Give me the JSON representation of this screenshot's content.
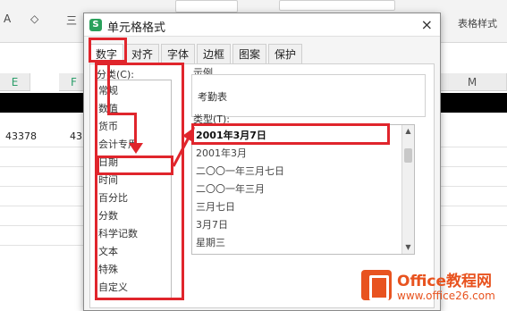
{
  "toolbar": {
    "font_glyph": "A",
    "fill_glyph": "◇",
    "align_glyph": "三",
    "table_style_label": "表格样式"
  },
  "grid": {
    "col_e": "E",
    "col_f": "F",
    "col_m": "M",
    "cell_e": "43378",
    "cell_f": "43"
  },
  "dialog": {
    "title": "单元格格式",
    "close_glyph": "×",
    "tabs": [
      "数字",
      "对齐",
      "字体",
      "边框",
      "图案",
      "保护"
    ],
    "category_label": "分类(C):",
    "categories": [
      "常规",
      "数值",
      "货币",
      "会计专用",
      "日期",
      "时间",
      "百分比",
      "分数",
      "科学记数",
      "文本",
      "特殊",
      "自定义"
    ],
    "sample_label": "示例",
    "sample_value": "考勤表",
    "type_label": "类型(T):",
    "types": [
      "2001年3月7日",
      "2001年3月",
      "二〇〇一年三月七日",
      "二〇〇一年三月",
      "三月七日",
      "3月7日",
      "星期三"
    ]
  },
  "watermark": {
    "title": "Office教程网",
    "url": "www.office26.com"
  },
  "colors": {
    "highlight": "#e0252c",
    "brand": "#e8531f"
  }
}
